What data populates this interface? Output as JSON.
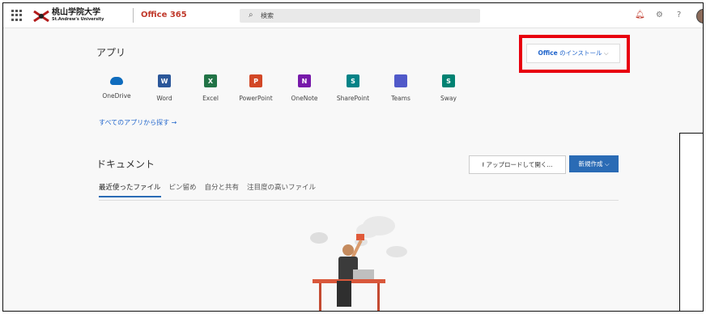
{
  "header": {
    "logo_text": "桃山学院大学",
    "logo_subtext": "St.Andrew's University",
    "brand": "Office 365",
    "search_placeholder": "検索"
  },
  "apps": {
    "title": "アプリ",
    "items": [
      {
        "label": "OneDrive",
        "color": "#0f6cbd",
        "icon": "onedrive-icon",
        "glyph": ""
      },
      {
        "label": "Word",
        "color": "#2b579a",
        "icon": "word-icon",
        "glyph": "W"
      },
      {
        "label": "Excel",
        "color": "#217346",
        "icon": "excel-icon",
        "glyph": "X"
      },
      {
        "label": "PowerPoint",
        "color": "#d24726",
        "icon": "powerpoint-icon",
        "glyph": "P"
      },
      {
        "label": "OneNote",
        "color": "#7719aa",
        "icon": "onenote-icon",
        "glyph": "N"
      },
      {
        "label": "SharePoint",
        "color": "#038387",
        "icon": "sharepoint-icon",
        "glyph": "S"
      },
      {
        "label": "Teams",
        "color": "#5059c9",
        "icon": "teams-icon",
        "glyph": ""
      },
      {
        "label": "Sway",
        "color": "#008272",
        "icon": "sway-icon",
        "glyph": "S"
      }
    ],
    "all_apps_link": "すべてのアプリから探す →"
  },
  "install": {
    "label_bold": "Office",
    "label_rest": " のインストール ",
    "chevron": "⌵"
  },
  "documents": {
    "title": "ドキュメント",
    "upload_label": "⭱ アップロードして開く...",
    "new_label": "新規作成 ⌵",
    "tabs": [
      "最近使ったファイル",
      "ピン留め",
      "自分と共有",
      "注目度の高いファイル"
    ]
  },
  "colors": {
    "accent": "#2a6bb5",
    "highlight": "#e8000e",
    "brand": "#c0392b"
  }
}
